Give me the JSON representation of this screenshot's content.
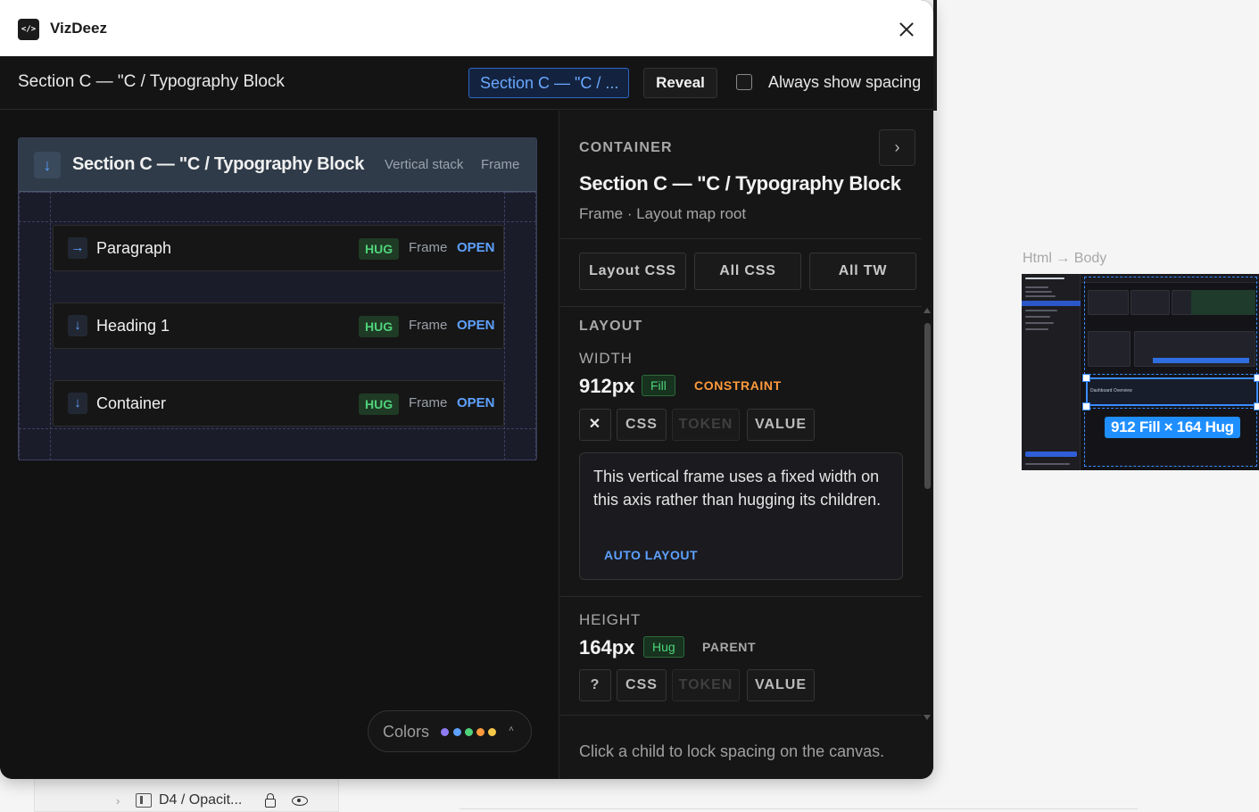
{
  "app": {
    "title": "VizDeez",
    "icon": "code-brackets-icon"
  },
  "header": {
    "title": "Section C — \"C / Typography Block",
    "crumb_select": "Section C — \"C / ...",
    "reveal_label": "Reveal",
    "always_show_spacing_label": "Always show spacing",
    "always_show_spacing_checked": false
  },
  "map": {
    "root": {
      "title": "Section C — \"C / Typography Block",
      "kind": "Vertical stack",
      "type": "Frame",
      "arrow": "↓"
    },
    "children": [
      {
        "arrow": "→",
        "name": "Paragraph",
        "sizing": "HUG",
        "type": "Frame",
        "action": "OPEN"
      },
      {
        "arrow": "↓",
        "name": "Heading 1",
        "sizing": "HUG",
        "type": "Frame",
        "action": "OPEN"
      },
      {
        "arrow": "↓",
        "name": "Container",
        "sizing": "HUG",
        "type": "Frame",
        "action": "OPEN"
      }
    ]
  },
  "colors_pill": {
    "label": "Colors",
    "dots": [
      "#8e7bf0",
      "#5ea1ff",
      "#4fd27a",
      "#ff9a3c",
      "#f5c84a"
    ]
  },
  "inspector": {
    "section_label": "CONTAINER",
    "next_glyph": "›",
    "title": "Section C — \"C / Typography Block",
    "subtitle": "Frame · Layout map root",
    "tabs": [
      "Layout CSS",
      "All CSS",
      "All TW"
    ],
    "layout_label": "LAYOUT",
    "width": {
      "label": "WIDTH",
      "value": "912px",
      "mode": "Fill",
      "tag": "CONSTRAINT",
      "status_glyph": "✕",
      "buttons": [
        "CSS",
        "TOKEN",
        "VALUE"
      ],
      "note": "This vertical frame uses a fixed width on this axis rather than hugging its children.",
      "note_link": "AUTO LAYOUT"
    },
    "height": {
      "label": "HEIGHT",
      "value": "164px",
      "mode": "Hug",
      "tag": "PARENT",
      "status_glyph": "?",
      "buttons": [
        "CSS",
        "TOKEN",
        "VALUE"
      ]
    },
    "footer_hint": "Click a child to lock spacing on the canvas."
  },
  "canvas": {
    "breadcrumb": "Html → Body",
    "selection_badge": "912 Fill × 164 Hug",
    "layer_row_label": "D4 / Opacit..."
  },
  "colors": {
    "accent": "#5ea1ff",
    "hug_green": "#4fd27a",
    "constraint_orange": "#ff9a3c",
    "panel_bg": "#121212"
  }
}
